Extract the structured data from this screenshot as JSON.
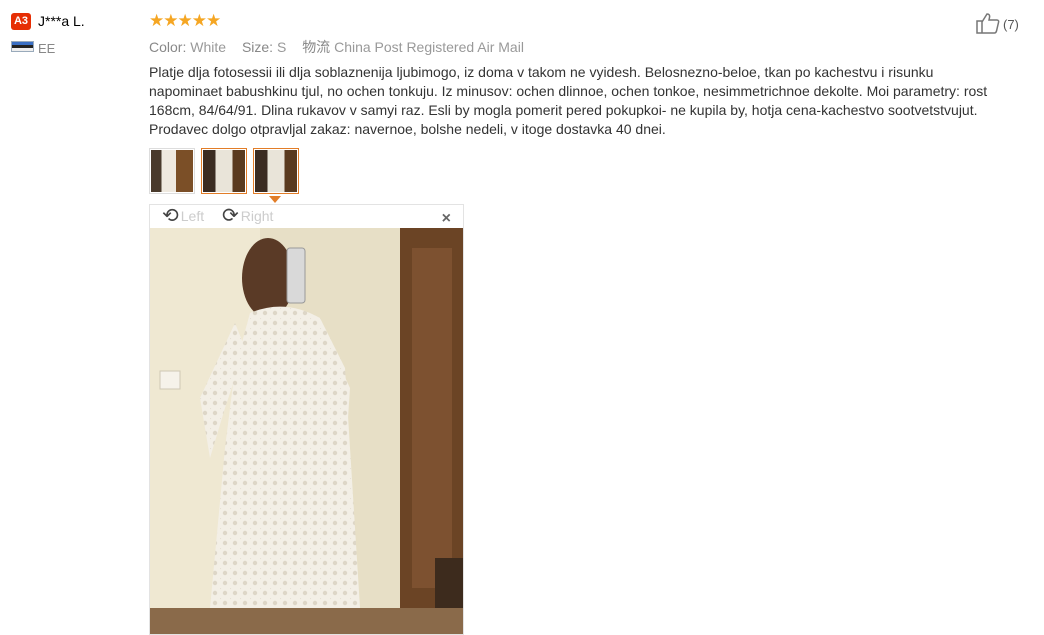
{
  "user": {
    "badge": "A3",
    "name": "J***a L.",
    "country": "EE"
  },
  "rating": {
    "stars": 5,
    "star_glyphs": "★★★★★"
  },
  "attributes": {
    "color_label": "Color:",
    "color_value": "White",
    "size_label": "Size:",
    "size_value": "S",
    "logistics_label": "物流",
    "logistics_value": "China Post Registered Air Mail"
  },
  "review_text": "Platje dlja fotosessii ili dlja soblaznenija ljubimogo, iz doma v takom ne vyidesh. Belosnezno-beloe, tkan po kachestvu i risunku napominaet babushkinu tjul, no ochen tonkuju. Iz minusov: ochen dlinnoe, ochen tonkoe, nesimmetrichnoe dekolte. Moi parametry: rost 168cm, 84/64/91. Dlina rukavov v samyi raz. Esli by mogla pomerit pered pokupkoi- ne kupila by, hotja cena-kachestvo sootvetstvujut. Prodavec dolgo otpravljal zakaz: navernoe, bolshe nedeli, v itoge dostavka 40 dnei.",
  "helpful": {
    "count_text": "(7)"
  },
  "viewer": {
    "left_label": "Left",
    "right_label": "Right",
    "close_glyph": "×"
  },
  "colors": {
    "accent": "#e27d28",
    "star": "#f5a623",
    "badge": "#e62e04"
  }
}
